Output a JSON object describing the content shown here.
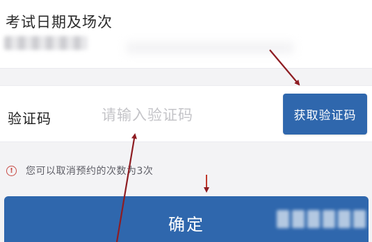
{
  "exam": {
    "label": "考试日期及场次"
  },
  "verification": {
    "label": "验证码",
    "input_placeholder": "请输入验证码",
    "input_value": "",
    "get_code_label": "获取验证码"
  },
  "notice": {
    "icon": "info-circle-icon",
    "text": "您可以取消预约的次数为3次"
  },
  "confirm": {
    "label": "确定"
  },
  "colors": {
    "primary_button": "#2f67ad",
    "annotation_arrow": "#8e1c22",
    "notice_icon": "#c84a44"
  }
}
